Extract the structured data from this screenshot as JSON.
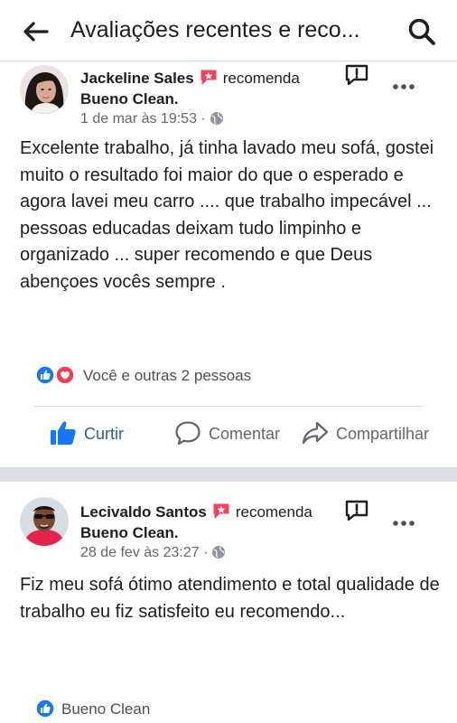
{
  "header": {
    "title": "Avaliações recentes e reco...",
    "back_icon": "arrow-left-icon",
    "search_icon": "search-icon"
  },
  "posts": [
    {
      "author": "Jackeline Sales",
      "recommends": "recomenda",
      "page": "Bueno Clean.",
      "date": "1 de mar às 19:53 ·",
      "text": "Excelente trabalho, já tinha lavado meu sofá, gostei muito o resultado foi maior do que o esperado e agora lavei meu carro .... que trabalho impecável ... pessoas educadas deixam tudo limpinho e organizado ... super recomendo e que Deus abençoes vocês sempre .",
      "reactions_text": "Você e outras 2 pessoas",
      "actions": {
        "like": "Curtir",
        "comment": "Comentar",
        "share": "Compartilhar"
      }
    },
    {
      "author": "Lecivaldo Santos",
      "recommends": "recomenda",
      "page": "Bueno Clean.",
      "date": "28 de fev às 23:27 ·",
      "text": "Fiz meu sofá ótimo atendimento e total qualidade de trabalho eu fiz satisfeito eu recomendo...",
      "reactions_text": "Bueno Clean"
    }
  ],
  "colors": {
    "like_blue": "#1877f2",
    "love_red": "#f33e58",
    "recommend_red": "#f5415b",
    "liked_text": "#385898"
  }
}
